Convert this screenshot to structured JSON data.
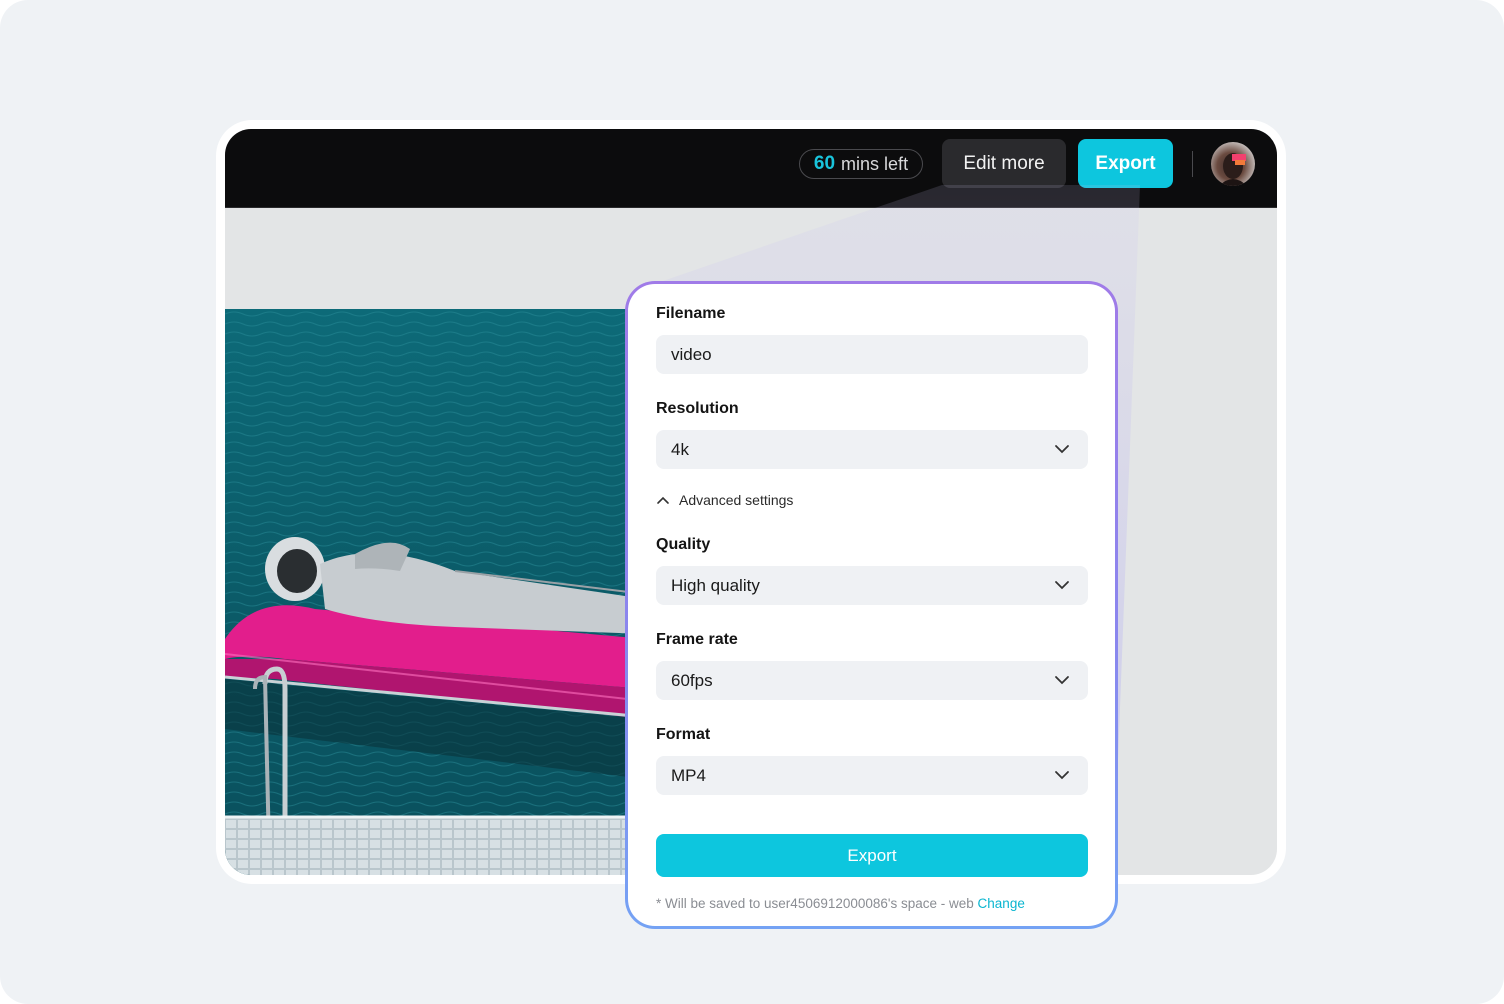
{
  "topbar": {
    "mins_number": "60",
    "mins_text": "mins left",
    "edit_more_label": "Edit more",
    "export_label": "Export"
  },
  "panel": {
    "filename_label": "Filename",
    "filename_value": "video",
    "resolution_label": "Resolution",
    "resolution_value": "4k",
    "advanced_label": "Advanced settings",
    "quality_label": "Quality",
    "quality_value": "High quality",
    "framerate_label": "Frame rate",
    "framerate_value": "60fps",
    "format_label": "Format",
    "format_value": "MP4",
    "export_button": "Export",
    "note_text": "* Will be saved to user4506912000086's space - web",
    "note_link": "Change"
  },
  "colors": {
    "accent": "#0dc6de",
    "topbar": "#0c0c0d",
    "page_bg": "#eff2f5",
    "panel_border": "#8a86ee"
  },
  "icons": [
    "chevron-down-icon",
    "chevron-up-icon",
    "avatar"
  ]
}
